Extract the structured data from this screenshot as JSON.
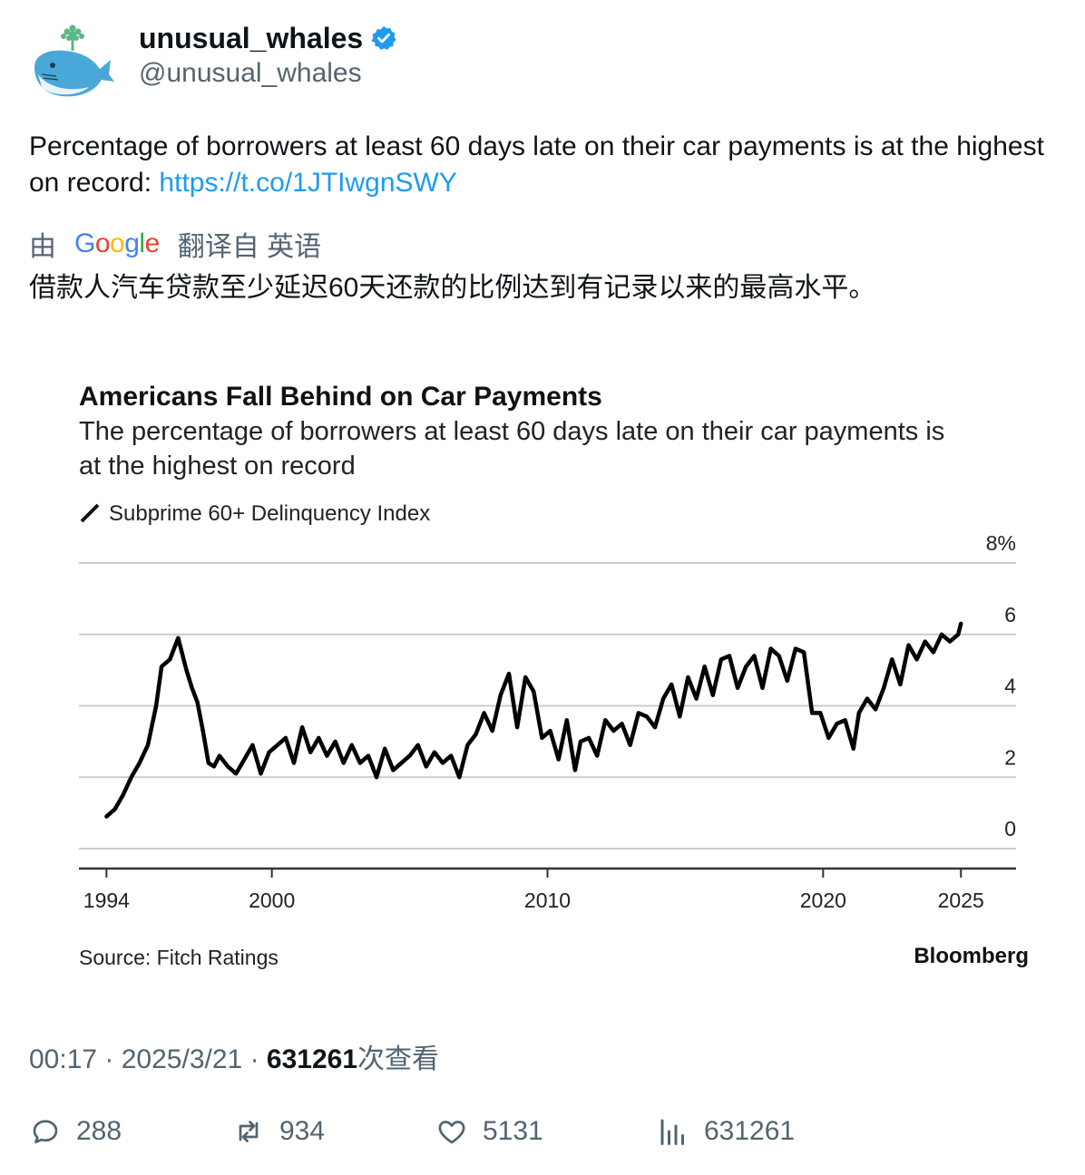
{
  "tweet": {
    "display_name": "unusual_whales",
    "handle": "@unusual_whales",
    "text_main": "Percentage of borrowers at least 60 days late on their car payments is at the highest on record: ",
    "link": "https://t.co/1JTIwgnSWY",
    "translate_prefix": "由",
    "translate_brand": "Google",
    "translate_suffix": "翻译自 英语",
    "translated_text": "借款人汽车贷款至少延迟60天还款的比例达到有记录以来的最高水平。",
    "time": "00:17",
    "date": "2025/3/21",
    "views": "631261",
    "views_label": "次查看"
  },
  "actions": {
    "replies": "288",
    "retweets": "934",
    "likes": "5131",
    "views": "631261"
  },
  "colors": {
    "link": "#1d9bf0",
    "muted": "#536471",
    "verified": "#1d9bf0"
  },
  "chart_data": {
    "type": "line",
    "title": "Americans Fall Behind on Car Payments",
    "subtitle": "The percentage of borrowers at least 60 days late on their car payments is at the highest on record",
    "legend": "Subprime 60+ Delinquency Index",
    "source": "Source: Fitch Ratings",
    "brand": "Bloomberg",
    "x_ticks": [
      "1994",
      "2000",
      "2010",
      "2020",
      "2025"
    ],
    "y_ticks": [
      "0",
      "2",
      "4",
      "6",
      "8%"
    ],
    "ylim": [
      0,
      8
    ],
    "xlim": [
      1993,
      2027
    ],
    "grid": true,
    "series": [
      {
        "name": "Subprime 60+ Delinquency Index",
        "x": [
          1994.0,
          1994.3,
          1994.6,
          1994.9,
          1995.2,
          1995.5,
          1995.8,
          1996.0,
          1996.3,
          1996.6,
          1996.9,
          1997.1,
          1997.3,
          1997.5,
          1997.7,
          1997.9,
          1998.1,
          1998.4,
          1998.7,
          1999.0,
          1999.3,
          1999.6,
          1999.9,
          2000.2,
          2000.5,
          2000.8,
          2001.1,
          2001.4,
          2001.7,
          2002.0,
          2002.3,
          2002.6,
          2002.9,
          2003.2,
          2003.5,
          2003.8,
          2004.1,
          2004.4,
          2004.7,
          2005.0,
          2005.3,
          2005.6,
          2005.9,
          2006.2,
          2006.5,
          2006.8,
          2007.1,
          2007.4,
          2007.7,
          2008.0,
          2008.3,
          2008.6,
          2008.9,
          2009.2,
          2009.5,
          2009.8,
          2010.1,
          2010.4,
          2010.7,
          2011.0,
          2011.2,
          2011.5,
          2011.8,
          2012.1,
          2012.4,
          2012.7,
          2013.0,
          2013.3,
          2013.6,
          2013.9,
          2014.2,
          2014.5,
          2014.8,
          2015.1,
          2015.4,
          2015.7,
          2016.0,
          2016.3,
          2016.6,
          2016.9,
          2017.2,
          2017.5,
          2017.8,
          2018.1,
          2018.4,
          2018.7,
          2019.0,
          2019.3,
          2019.6,
          2019.9,
          2020.2,
          2020.5,
          2020.8,
          2021.1,
          2021.3,
          2021.6,
          2021.9,
          2022.2,
          2022.5,
          2022.8,
          2023.1,
          2023.4,
          2023.7,
          2024.0,
          2024.3,
          2024.6,
          2024.9,
          2025.0
        ],
        "values": [
          0.9,
          1.1,
          1.5,
          2.0,
          2.4,
          2.9,
          4.0,
          5.1,
          5.3,
          5.9,
          5.0,
          4.5,
          4.1,
          3.3,
          2.4,
          2.3,
          2.6,
          2.3,
          2.1,
          2.5,
          2.9,
          2.1,
          2.7,
          2.9,
          3.1,
          2.4,
          3.4,
          2.7,
          3.1,
          2.6,
          3.0,
          2.4,
          2.9,
          2.4,
          2.6,
          2.0,
          2.8,
          2.2,
          2.4,
          2.6,
          2.9,
          2.3,
          2.7,
          2.4,
          2.6,
          2.0,
          2.9,
          3.2,
          3.8,
          3.3,
          4.3,
          4.9,
          3.4,
          4.8,
          4.4,
          3.1,
          3.3,
          2.5,
          3.6,
          2.2,
          3.0,
          3.1,
          2.6,
          3.6,
          3.3,
          3.5,
          2.9,
          3.8,
          3.7,
          3.4,
          4.2,
          4.6,
          3.7,
          4.8,
          4.2,
          5.1,
          4.3,
          5.3,
          5.4,
          4.5,
          5.1,
          5.4,
          4.5,
          5.6,
          5.4,
          4.7,
          5.6,
          5.5,
          3.8,
          3.8,
          3.1,
          3.5,
          3.6,
          2.8,
          3.8,
          4.2,
          3.9,
          4.5,
          5.3,
          4.6,
          5.7,
          5.3,
          5.8,
          5.5,
          6.0,
          5.8,
          6.0,
          6.3
        ]
      }
    ]
  }
}
